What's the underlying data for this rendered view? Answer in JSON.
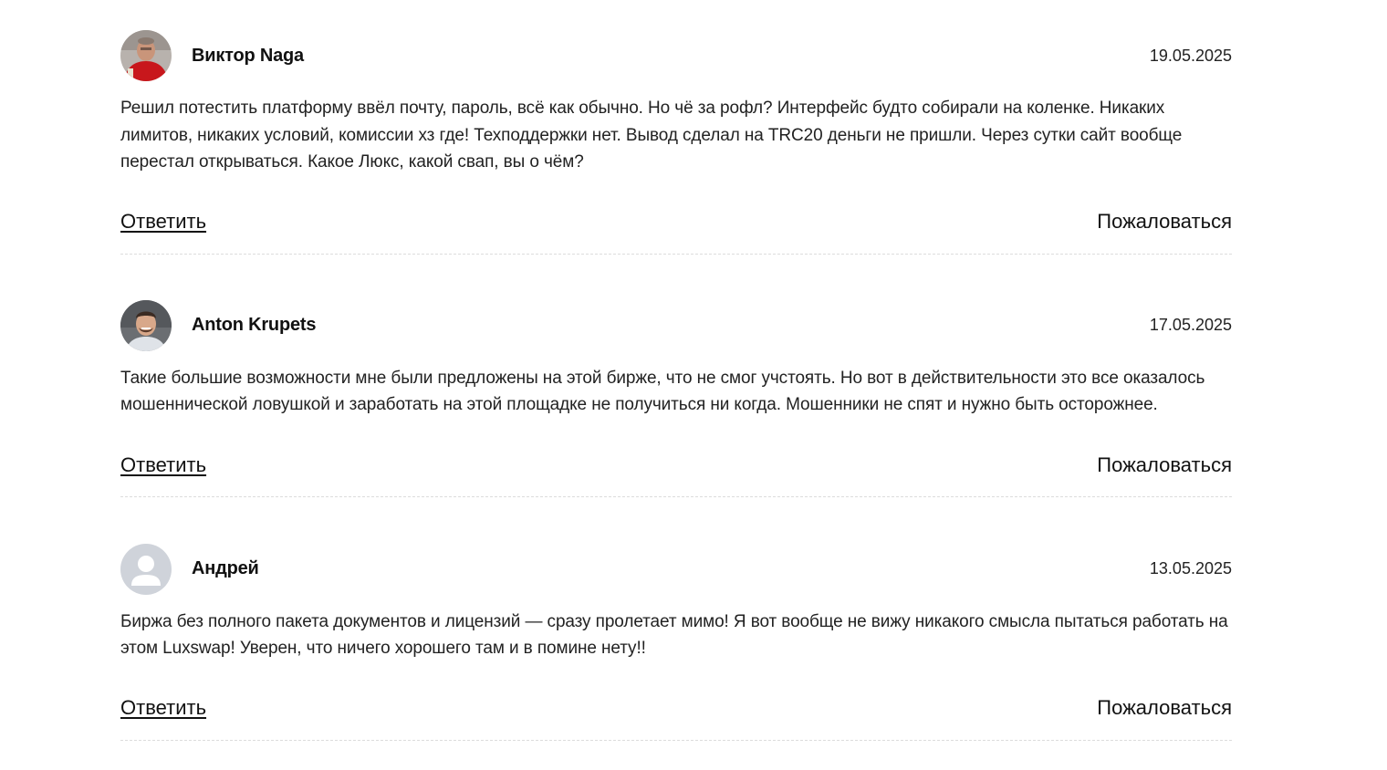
{
  "comments": [
    {
      "author": "Виктор Naga",
      "avatar": "user-photo-man-red-shirt",
      "date": "19.05.2025",
      "text": "Решил потестить платформу ввёл почту, пароль, всё как обычно. Но чё за рофл? Интерфейс будто собирали на коленке. Никаких лимитов, никаких условий, комиссии хз где! Техподдержки нет. Вывод сделал на TRC20 деньги не пришли. Через сутки сайт вообще перестал открываться. Какое Люкс, какой свап, вы о чём?",
      "reply_label": "Ответить",
      "report_label": "Пожаловаться"
    },
    {
      "author": "Anton Krupets",
      "avatar": "user-photo-man-smiling",
      "date": "17.05.2025",
      "text": "Такие большие возможности мне были предложены на этой бирже, что не смог учстоять. Но вот в действительности это все оказалось мошеннической ловушкой и заработать на этой площадке не получиться ни когда. Мошенники не спят и нужно быть осторожнее.",
      "reply_label": "Ответить",
      "report_label": "Пожаловаться"
    },
    {
      "author": "Андрей",
      "avatar": "default-user-icon",
      "date": "13.05.2025",
      "text": "Биржа без полного пакета документов и лицензий — сразу пролетает мимо! Я вот вообще не вижу никакого смысла пытаться работать на этом Luxswap! Уверен, что ничего хорошего там и в помине нету!!",
      "reply_label": "Ответить",
      "report_label": "Пожаловаться"
    }
  ],
  "colors": {
    "text": "#222222",
    "divider": "#dcdcdc",
    "default_avatar_bg": "#cfd3da",
    "default_avatar_fg": "#ffffff"
  }
}
